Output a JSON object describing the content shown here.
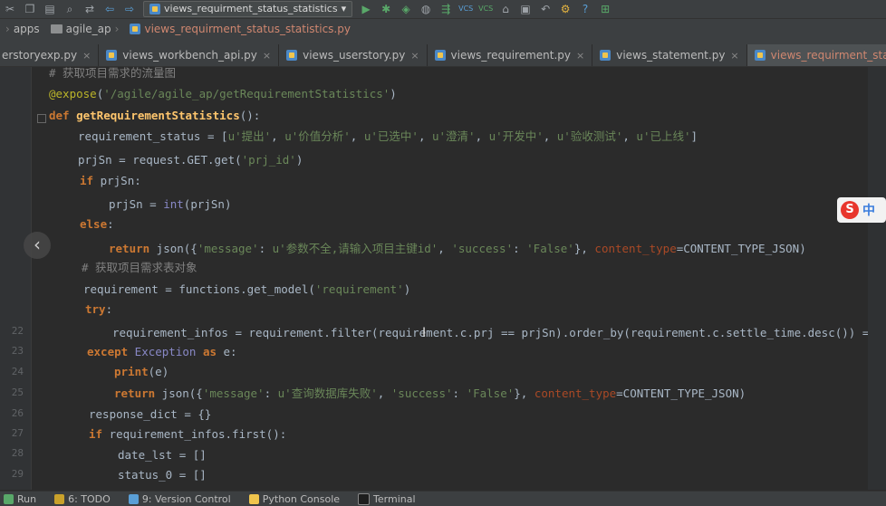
{
  "toolbar": {
    "run_config": "views_requirment_status_statistics",
    "icons": [
      "cut-icon",
      "copy-icon",
      "paste-icon",
      "find-icon",
      "replace-icon",
      "back-icon",
      "forward-icon",
      "run-icon",
      "debug-icon",
      "coverage-icon",
      "profile-icon",
      "build-icon",
      "vcs-update-icon",
      "vcs-commit-icon",
      "history-icon",
      "revert-icon",
      "settings-icon",
      "help-icon",
      "sdk-icon"
    ],
    "vcs_label_1": "VCS",
    "vcs_label_2": "VCS",
    "help_label": "?"
  },
  "breadcrumb": {
    "items": [
      "apps",
      "agile_ap",
      "views_requirment_status_statistics.py"
    ]
  },
  "tabs": [
    {
      "label": "erstoryexp.py",
      "active": false
    },
    {
      "label": "views_workbench_api.py",
      "active": false
    },
    {
      "label": "views_userstory.py",
      "active": false
    },
    {
      "label": "views_requirement.py",
      "active": false
    },
    {
      "label": "views_statement.py",
      "active": false
    },
    {
      "label": "views_requirment_status_statistics.py",
      "active": true
    }
  ],
  "gutter": {
    "line_numbers": [
      "",
      "",
      "",
      "",
      "",
      "",
      "",
      "",
      "",
      "",
      "",
      "",
      "22",
      "23",
      "24",
      "25",
      "26",
      "27",
      "28",
      "29"
    ]
  },
  "code": {
    "l01_comment": "# 获取项目需求的流量图",
    "l02_at": "@",
    "l02_dec": "expose",
    "l02_open": "(",
    "l02_str": "'/agile/agile_ap/getRequirementStatistics'",
    "l02_close": ")",
    "l03_def": "def",
    "l03_fn": "getRequirementStatistics",
    "l03_rest": "():",
    "l04_a": "requirement_status = [",
    "l04_s1": "u'提出'",
    "l04_c1": ", ",
    "l04_s2": "u'价值分析'",
    "l04_c2": ", ",
    "l04_s3": "u'已选中'",
    "l04_c3": ", ",
    "l04_s4": "u'澄清'",
    "l04_c4": ", ",
    "l04_s5": "u'开发中'",
    "l04_c5": ", ",
    "l04_s6": "u'验收测试'",
    "l04_c6": ", ",
    "l04_s7": "u'已上线'",
    "l04_end": "]",
    "l05_a": "prjSn = request.GET.get(",
    "l05_s": "'prj_id'",
    "l05_end": ")",
    "l06_kw": "if",
    "l06_rest": " prjSn:",
    "l07_a": "prjSn = ",
    "l07_b": "int",
    "l07_c": "(prjSn)",
    "l08_kw": "else",
    "l08_rest": ":",
    "l09_kw": "return",
    "l09_a": " json({",
    "l09_s1": "'message'",
    "l09_b": ": ",
    "l09_s2": "u'参数不全,请输入项目主键id'",
    "l09_c": ", ",
    "l09_s3": "'success'",
    "l09_d": ": ",
    "l09_s4": "'False'",
    "l09_e": "}, ",
    "l09_kwarg": "content_type",
    "l09_f": "=CONTENT_TYPE_JSON)",
    "l10_comment": "# 获取项目需求表对象",
    "l11_a": "requirement = functions.get_model(",
    "l11_s": "'requirement'",
    "l11_end": ")",
    "l12_kw": "try",
    "l12_rest": ":",
    "l13_a": "requirement_infos = requirement.filter(requirement.c.prj == prjSn).order_by(requirement.c.settle_time.desc()) =",
    "l14_kw1": "except",
    "l14_cls": " Exception",
    "l14_kw2": " as",
    "l14_rest": " e:",
    "l15_kw": "print",
    "l15_rest": "(e)",
    "l16_kw": "return",
    "l16_a": " json({",
    "l16_s1": "'message'",
    "l16_b": ": ",
    "l16_s2": "u'查询数据库失败'",
    "l16_c": ", ",
    "l16_s3": "'success'",
    "l16_d": ": ",
    "l16_s4": "'False'",
    "l16_e": "}, ",
    "l16_kwarg": "content_type",
    "l16_f": "=CONTENT_TYPE_JSON)",
    "l17_a": "response_dict = {}",
    "l18_kw": "if",
    "l18_rest": " requirement_infos.first():",
    "l19_a": "date_lst = []",
    "l20_a": "status_0 = []"
  },
  "ime": {
    "logo": "S",
    "mode": "中"
  },
  "statusbar": [
    {
      "label": "Run",
      "name": "run"
    },
    {
      "label": "6: TODO",
      "name": "todo"
    },
    {
      "label": "9: Version Control",
      "name": "version-control"
    },
    {
      "label": "Python Console",
      "name": "python-console"
    },
    {
      "label": "Terminal",
      "name": "terminal"
    }
  ],
  "colors": {
    "keyword": "#cc7832",
    "string": "#6a8759",
    "function": "#ffc66d",
    "comment": "#808080",
    "decorator": "#bbb529"
  }
}
